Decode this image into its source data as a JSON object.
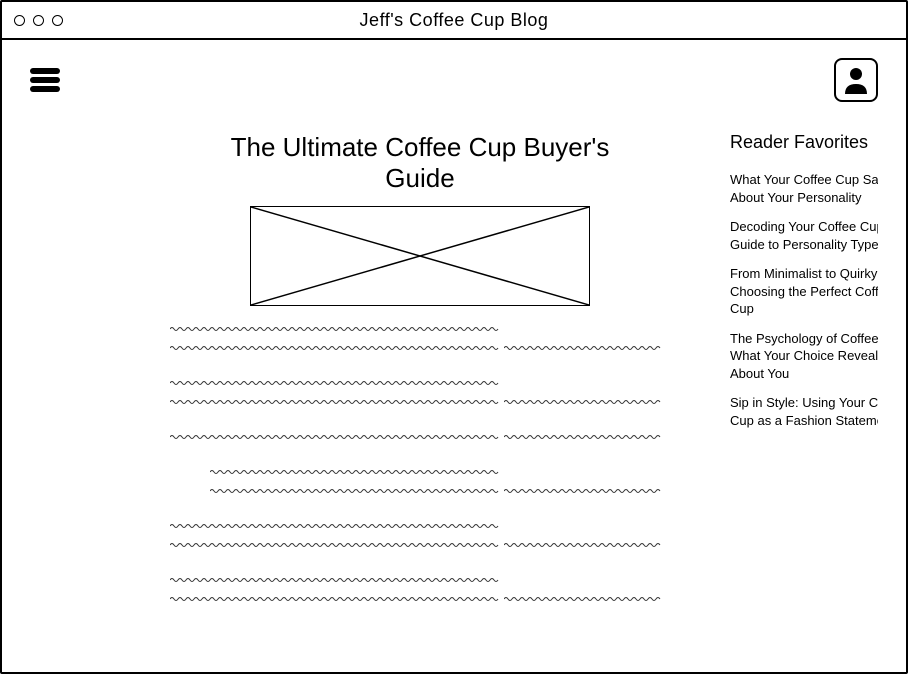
{
  "window": {
    "title": "Jeff's Coffee Cup Blog"
  },
  "article": {
    "title": "The Ultimate Coffee Cup Buyer's Guide"
  },
  "sidebar": {
    "title": "Reader Favorites",
    "items": [
      "What Your Coffee Cup Says About Your Personality",
      "Decoding Your Coffee Cup: A Guide to Personality Types",
      "From Minimalist to Quirky: Choosing the Perfect Coffee Cup",
      "The Psychology of Coffee Cups: What Your Choice Reveals About You",
      "Sip in Style: Using Your Coffee Cup as a Fashion Statement"
    ]
  }
}
